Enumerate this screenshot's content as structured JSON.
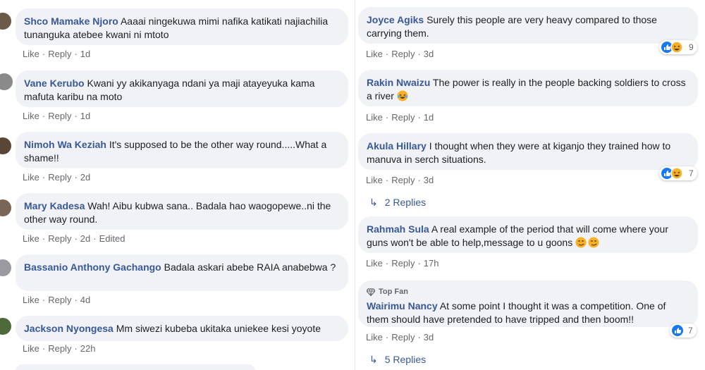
{
  "actions": {
    "like": "Like",
    "reply": "Reply",
    "separator": "·",
    "edited": "Edited"
  },
  "left": [
    {
      "name": "Shco Mamake Njoro",
      "text": "Aaaai ningekuwa mimi nafika katikati najiachilia tunanguka atebee kwani ni mtoto",
      "time": "1d"
    },
    {
      "name": "Vane Kerubo",
      "text": "Kwani yy akikanyaga ndani ya maji atayeyuka kama mafuta karibu na moto",
      "time": "1d"
    },
    {
      "name": "Nimoh Wa Keziah",
      "text": "It's supposed to be the other way round.....What a shame!!",
      "time": "2d"
    },
    {
      "name": "Mary Kadesa",
      "text": "Wah! Aibu kubwa sana.. Badala hao waogopewe..ni the other way round.",
      "time": "2d"
    },
    {
      "name": "Bassanio Anthony Gachango",
      "text": "Badala askari abebe RAIA anabebwa ?",
      "time": "4d"
    },
    {
      "name": "Jackson Nyongesa",
      "text": "Mm siwezi kubeba ukitaka uniekee kesi yoyote",
      "time": "22h"
    }
  ],
  "right": [
    {
      "name": "Joyce Agiks",
      "text": "Surely this people are very heavy compared to those carrying them.",
      "time": "3d",
      "reactions": "9",
      "reaction_icons": [
        "like-icon",
        "haha-icon"
      ]
    },
    {
      "name": "Rakin Nwaizu",
      "text": "The power is really in the people backing soldiers to cross a river",
      "time": "1d",
      "emoji": "laugh-emoji"
    },
    {
      "name": "Akula Hillary",
      "text": "I thought when they were at kiganjo they trained how to manuva in serch situations.",
      "time": "3d",
      "reactions": "7",
      "reaction_icons": [
        "like-icon",
        "haha-icon"
      ],
      "replies": "2 Replies"
    },
    {
      "name": "Rahmah Sula",
      "text": "A real example of the period that will come where your guns won't be able to help,message to u goons",
      "time": "17h",
      "emoji": "smirk-emoji"
    },
    {
      "badge": "Top Fan",
      "name": "Wairimu Nancy",
      "text": "At some point I thought it was a competition. One of them should have pretended to have tripped and then boom!!",
      "time": "3d",
      "reactions": "7",
      "reaction_icons": [
        "like-icon"
      ],
      "replies": "5 Replies"
    }
  ]
}
